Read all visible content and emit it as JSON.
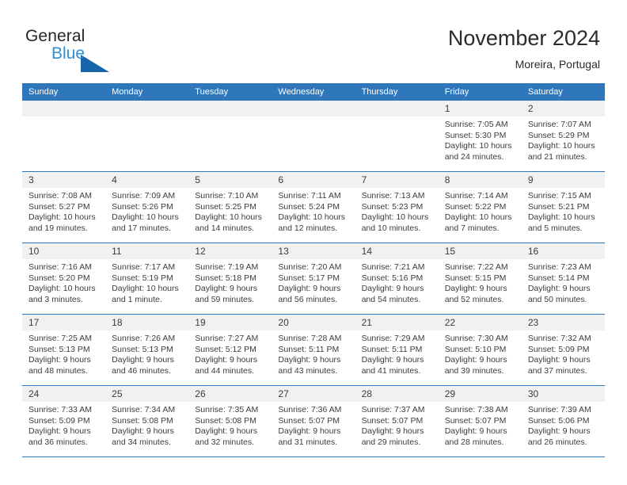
{
  "brand": {
    "name_part1": "General",
    "name_part2": "Blue",
    "triangle_color": "#1565a8",
    "blue_color": "#2d8fd5"
  },
  "header": {
    "title": "November 2024",
    "subtitle": "Moreira, Portugal",
    "header_bg": "#2e77bb",
    "daynum_bg": "#f1f1f1"
  },
  "weekday_headers": [
    "Sunday",
    "Monday",
    "Tuesday",
    "Wednesday",
    "Thursday",
    "Friday",
    "Saturday"
  ],
  "weeks": [
    [
      {
        "day": "",
        "empty": true
      },
      {
        "day": "",
        "empty": true
      },
      {
        "day": "",
        "empty": true
      },
      {
        "day": "",
        "empty": true
      },
      {
        "day": "",
        "empty": true
      },
      {
        "day": "1",
        "sunrise": "Sunrise: 7:05 AM",
        "sunset": "Sunset: 5:30 PM",
        "daylight": "Daylight: 10 hours and 24 minutes."
      },
      {
        "day": "2",
        "sunrise": "Sunrise: 7:07 AM",
        "sunset": "Sunset: 5:29 PM",
        "daylight": "Daylight: 10 hours and 21 minutes."
      }
    ],
    [
      {
        "day": "3",
        "sunrise": "Sunrise: 7:08 AM",
        "sunset": "Sunset: 5:27 PM",
        "daylight": "Daylight: 10 hours and 19 minutes."
      },
      {
        "day": "4",
        "sunrise": "Sunrise: 7:09 AM",
        "sunset": "Sunset: 5:26 PM",
        "daylight": "Daylight: 10 hours and 17 minutes."
      },
      {
        "day": "5",
        "sunrise": "Sunrise: 7:10 AM",
        "sunset": "Sunset: 5:25 PM",
        "daylight": "Daylight: 10 hours and 14 minutes."
      },
      {
        "day": "6",
        "sunrise": "Sunrise: 7:11 AM",
        "sunset": "Sunset: 5:24 PM",
        "daylight": "Daylight: 10 hours and 12 minutes."
      },
      {
        "day": "7",
        "sunrise": "Sunrise: 7:13 AM",
        "sunset": "Sunset: 5:23 PM",
        "daylight": "Daylight: 10 hours and 10 minutes."
      },
      {
        "day": "8",
        "sunrise": "Sunrise: 7:14 AM",
        "sunset": "Sunset: 5:22 PM",
        "daylight": "Daylight: 10 hours and 7 minutes."
      },
      {
        "day": "9",
        "sunrise": "Sunrise: 7:15 AM",
        "sunset": "Sunset: 5:21 PM",
        "daylight": "Daylight: 10 hours and 5 minutes."
      }
    ],
    [
      {
        "day": "10",
        "sunrise": "Sunrise: 7:16 AM",
        "sunset": "Sunset: 5:20 PM",
        "daylight": "Daylight: 10 hours and 3 minutes."
      },
      {
        "day": "11",
        "sunrise": "Sunrise: 7:17 AM",
        "sunset": "Sunset: 5:19 PM",
        "daylight": "Daylight: 10 hours and 1 minute."
      },
      {
        "day": "12",
        "sunrise": "Sunrise: 7:19 AM",
        "sunset": "Sunset: 5:18 PM",
        "daylight": "Daylight: 9 hours and 59 minutes."
      },
      {
        "day": "13",
        "sunrise": "Sunrise: 7:20 AM",
        "sunset": "Sunset: 5:17 PM",
        "daylight": "Daylight: 9 hours and 56 minutes."
      },
      {
        "day": "14",
        "sunrise": "Sunrise: 7:21 AM",
        "sunset": "Sunset: 5:16 PM",
        "daylight": "Daylight: 9 hours and 54 minutes."
      },
      {
        "day": "15",
        "sunrise": "Sunrise: 7:22 AM",
        "sunset": "Sunset: 5:15 PM",
        "daylight": "Daylight: 9 hours and 52 minutes."
      },
      {
        "day": "16",
        "sunrise": "Sunrise: 7:23 AM",
        "sunset": "Sunset: 5:14 PM",
        "daylight": "Daylight: 9 hours and 50 minutes."
      }
    ],
    [
      {
        "day": "17",
        "sunrise": "Sunrise: 7:25 AM",
        "sunset": "Sunset: 5:13 PM",
        "daylight": "Daylight: 9 hours and 48 minutes."
      },
      {
        "day": "18",
        "sunrise": "Sunrise: 7:26 AM",
        "sunset": "Sunset: 5:13 PM",
        "daylight": "Daylight: 9 hours and 46 minutes."
      },
      {
        "day": "19",
        "sunrise": "Sunrise: 7:27 AM",
        "sunset": "Sunset: 5:12 PM",
        "daylight": "Daylight: 9 hours and 44 minutes."
      },
      {
        "day": "20",
        "sunrise": "Sunrise: 7:28 AM",
        "sunset": "Sunset: 5:11 PM",
        "daylight": "Daylight: 9 hours and 43 minutes."
      },
      {
        "day": "21",
        "sunrise": "Sunrise: 7:29 AM",
        "sunset": "Sunset: 5:11 PM",
        "daylight": "Daylight: 9 hours and 41 minutes."
      },
      {
        "day": "22",
        "sunrise": "Sunrise: 7:30 AM",
        "sunset": "Sunset: 5:10 PM",
        "daylight": "Daylight: 9 hours and 39 minutes."
      },
      {
        "day": "23",
        "sunrise": "Sunrise: 7:32 AM",
        "sunset": "Sunset: 5:09 PM",
        "daylight": "Daylight: 9 hours and 37 minutes."
      }
    ],
    [
      {
        "day": "24",
        "sunrise": "Sunrise: 7:33 AM",
        "sunset": "Sunset: 5:09 PM",
        "daylight": "Daylight: 9 hours and 36 minutes."
      },
      {
        "day": "25",
        "sunrise": "Sunrise: 7:34 AM",
        "sunset": "Sunset: 5:08 PM",
        "daylight": "Daylight: 9 hours and 34 minutes."
      },
      {
        "day": "26",
        "sunrise": "Sunrise: 7:35 AM",
        "sunset": "Sunset: 5:08 PM",
        "daylight": "Daylight: 9 hours and 32 minutes."
      },
      {
        "day": "27",
        "sunrise": "Sunrise: 7:36 AM",
        "sunset": "Sunset: 5:07 PM",
        "daylight": "Daylight: 9 hours and 31 minutes."
      },
      {
        "day": "28",
        "sunrise": "Sunrise: 7:37 AM",
        "sunset": "Sunset: 5:07 PM",
        "daylight": "Daylight: 9 hours and 29 minutes."
      },
      {
        "day": "29",
        "sunrise": "Sunrise: 7:38 AM",
        "sunset": "Sunset: 5:07 PM",
        "daylight": "Daylight: 9 hours and 28 minutes."
      },
      {
        "day": "30",
        "sunrise": "Sunrise: 7:39 AM",
        "sunset": "Sunset: 5:06 PM",
        "daylight": "Daylight: 9 hours and 26 minutes."
      }
    ]
  ]
}
